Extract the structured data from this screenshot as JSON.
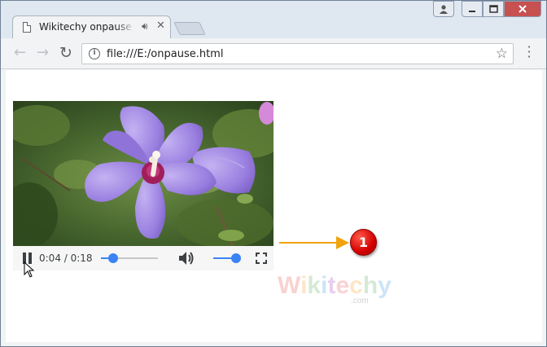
{
  "browser": {
    "tab_title": "Wikitechy onpause attribute",
    "tab_close": "✕",
    "url": "file:///E:/onpause.html"
  },
  "icons": {
    "page": "page-icon",
    "speaker": "speaker-icon",
    "back": "back-arrow-icon",
    "forward": "forward-arrow-icon",
    "reload": "reload-icon",
    "info": "info-icon",
    "star": "star-icon",
    "menu": "menu-dots-icon",
    "pause": "pause-icon",
    "volume": "volume-icon",
    "fullscreen": "fullscreen-icon",
    "cursor": "mouse-cursor-icon"
  },
  "video": {
    "current_time": "0:04",
    "duration": "0:18",
    "time_display": "0:04 / 0:18",
    "progress_fraction": 0.22,
    "volume_fraction": 1.0
  },
  "annotation": {
    "callout_number": "1",
    "arrow_color": "#f0a30a",
    "callout_color": "#d30000"
  },
  "watermark": {
    "text": "Wikitechy",
    "sub": ".com"
  },
  "colors": {
    "accent": "#3b82f6",
    "close_button": "#c75050"
  }
}
